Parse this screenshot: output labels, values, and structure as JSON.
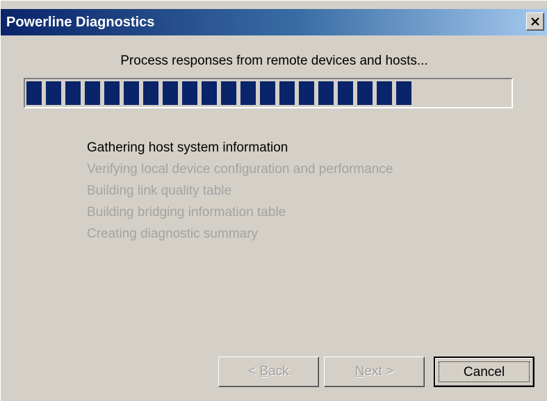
{
  "window": {
    "title": "Powerline Diagnostics",
    "close_icon": "close-x-icon"
  },
  "progress": {
    "label": "Process responses from remote devices and hosts...",
    "filled_segments": 20,
    "fraction": 0.79
  },
  "steps": [
    {
      "label": "Gathering host system information",
      "state": "active"
    },
    {
      "label": "Verifying local device configuration and performance",
      "state": "pending"
    },
    {
      "label": "Building link quality table",
      "state": "pending"
    },
    {
      "label": "Building bridging information table",
      "state": "pending"
    },
    {
      "label": "Creating diagnostic summary",
      "state": "pending"
    }
  ],
  "buttons": {
    "back": {
      "prefix": "< ",
      "mnemonic": "B",
      "rest": "ack",
      "enabled": false
    },
    "next": {
      "prefix": "",
      "mnemonic": "N",
      "rest": "ext >",
      "enabled": false
    },
    "cancel": {
      "label": "Cancel",
      "enabled": true
    }
  },
  "colors": {
    "titlebar_start": "#0a246a",
    "titlebar_end": "#a6caf0",
    "progress_fill": "#0a246a",
    "dialog_bg": "#d4d0c8"
  }
}
